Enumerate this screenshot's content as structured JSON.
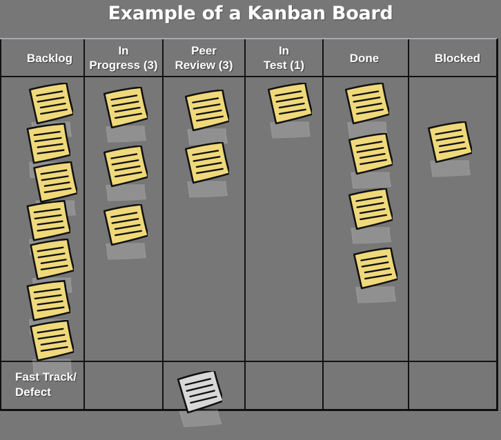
{
  "title": "Example of a Kanban Board",
  "colors": {
    "background": "#777777",
    "card_yellow": "#efd97a",
    "card_grey": "#d8d8d8",
    "card_outline": "#111111",
    "grid_line": "#111111",
    "text": "#ffffff"
  },
  "columns": [
    {
      "id": "backlog",
      "label": "Backlog",
      "wip": null,
      "card_count": 7
    },
    {
      "id": "in-progress",
      "label": "In\nProgress (3)",
      "wip": 3,
      "card_count": 3
    },
    {
      "id": "peer-review",
      "label": "Peer\nReview (3)",
      "wip": 3,
      "card_count": 2
    },
    {
      "id": "in-test",
      "label": "In\nTest (1)",
      "wip": 1,
      "card_count": 1
    },
    {
      "id": "done",
      "label": "Done",
      "wip": null,
      "card_count": 4
    },
    {
      "id": "blocked",
      "label": "Blocked",
      "wip": null,
      "card_count": 1
    }
  ],
  "swimlanes": [
    {
      "id": "standard",
      "label": ""
    },
    {
      "id": "fast-track",
      "label": "Fast Track/\nDefect"
    }
  ],
  "cards": [
    {
      "column": "backlog",
      "lane": "standard",
      "color": "yellow",
      "icon": "sticky-note-icon"
    },
    {
      "column": "backlog",
      "lane": "standard",
      "color": "yellow",
      "icon": "sticky-note-icon"
    },
    {
      "column": "backlog",
      "lane": "standard",
      "color": "yellow",
      "icon": "sticky-note-icon"
    },
    {
      "column": "backlog",
      "lane": "standard",
      "color": "yellow",
      "icon": "sticky-note-icon"
    },
    {
      "column": "backlog",
      "lane": "standard",
      "color": "yellow",
      "icon": "sticky-note-icon"
    },
    {
      "column": "backlog",
      "lane": "standard",
      "color": "yellow",
      "icon": "sticky-note-icon"
    },
    {
      "column": "backlog",
      "lane": "standard",
      "color": "yellow",
      "icon": "sticky-note-icon"
    },
    {
      "column": "in-progress",
      "lane": "standard",
      "color": "yellow",
      "icon": "sticky-note-icon"
    },
    {
      "column": "in-progress",
      "lane": "standard",
      "color": "yellow",
      "icon": "sticky-note-icon"
    },
    {
      "column": "in-progress",
      "lane": "standard",
      "color": "yellow",
      "icon": "sticky-note-icon"
    },
    {
      "column": "peer-review",
      "lane": "standard",
      "color": "yellow",
      "icon": "sticky-note-icon"
    },
    {
      "column": "peer-review",
      "lane": "standard",
      "color": "yellow",
      "icon": "sticky-note-icon"
    },
    {
      "column": "peer-review",
      "lane": "fast-track",
      "color": "grey",
      "icon": "sticky-note-icon"
    },
    {
      "column": "in-test",
      "lane": "standard",
      "color": "yellow",
      "icon": "sticky-note-icon"
    },
    {
      "column": "done",
      "lane": "standard",
      "color": "yellow",
      "icon": "sticky-note-icon"
    },
    {
      "column": "done",
      "lane": "standard",
      "color": "yellow",
      "icon": "sticky-note-icon"
    },
    {
      "column": "done",
      "lane": "standard",
      "color": "yellow",
      "icon": "sticky-note-icon"
    },
    {
      "column": "done",
      "lane": "standard",
      "color": "yellow",
      "icon": "sticky-note-icon"
    },
    {
      "column": "blocked",
      "lane": "standard",
      "color": "yellow",
      "icon": "sticky-note-icon"
    }
  ]
}
